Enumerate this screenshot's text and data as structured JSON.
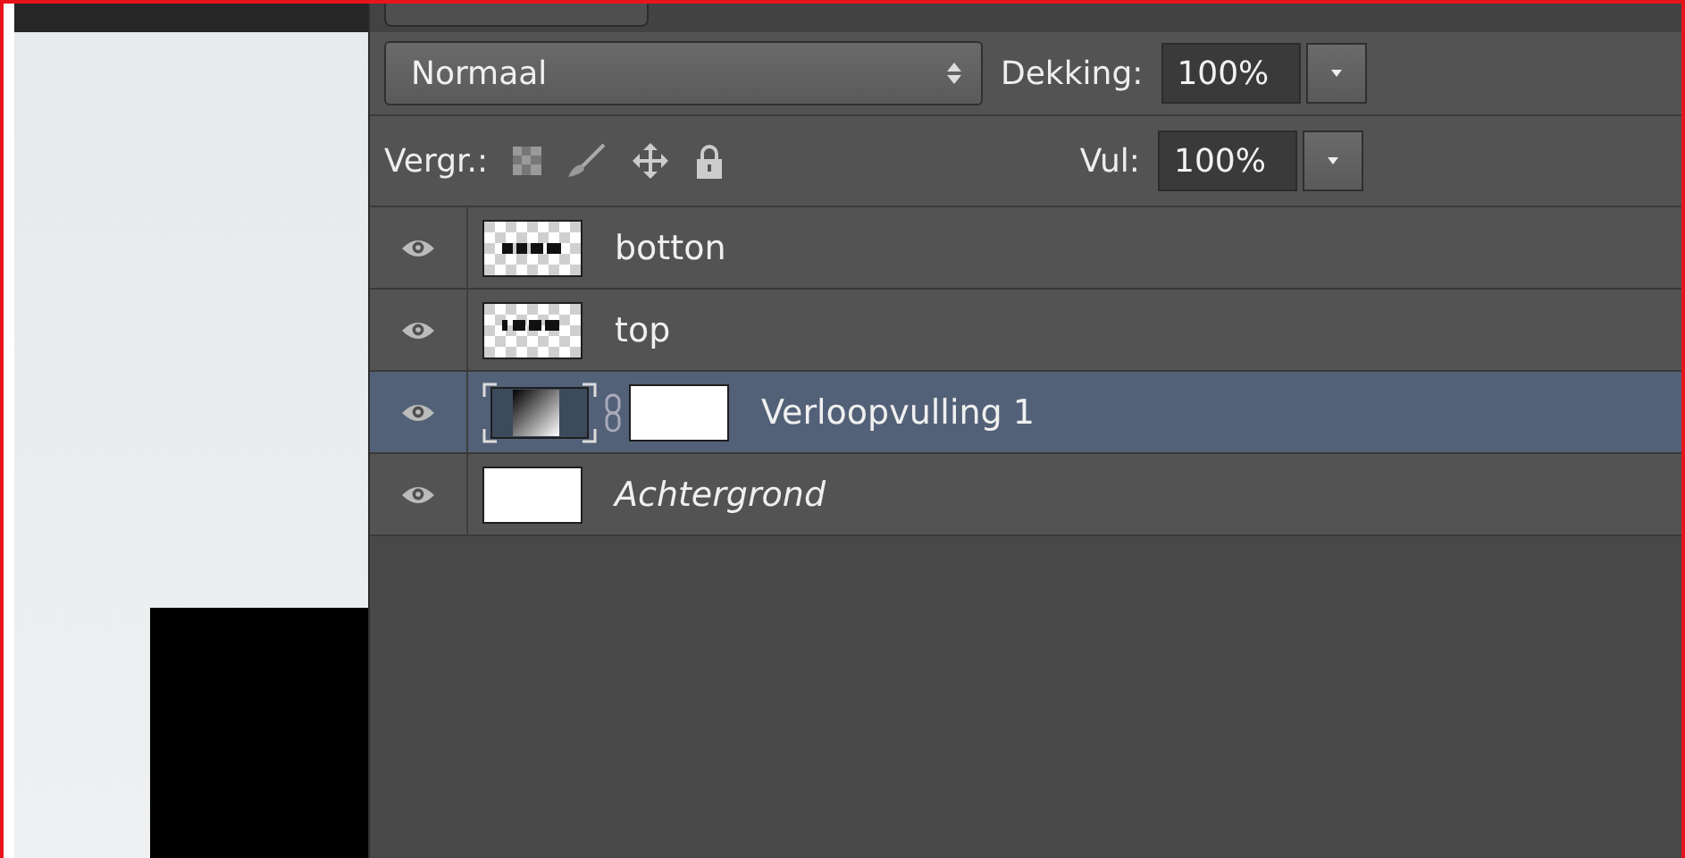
{
  "blend_mode": {
    "value": "Normaal"
  },
  "opacity": {
    "label": "Dekking:",
    "value": "100%"
  },
  "lock": {
    "label": "Vergr.:"
  },
  "fill": {
    "label": "Vul:",
    "value": "100%"
  },
  "layers": [
    {
      "name": "botton",
      "kind": "pixel",
      "visible": true,
      "selected": false
    },
    {
      "name": "top",
      "kind": "pixel",
      "visible": true,
      "selected": false
    },
    {
      "name": "Verloopvulling 1",
      "kind": "gradient-fill",
      "visible": true,
      "selected": true
    },
    {
      "name": "Achtergrond",
      "kind": "background",
      "visible": true,
      "selected": false
    }
  ]
}
